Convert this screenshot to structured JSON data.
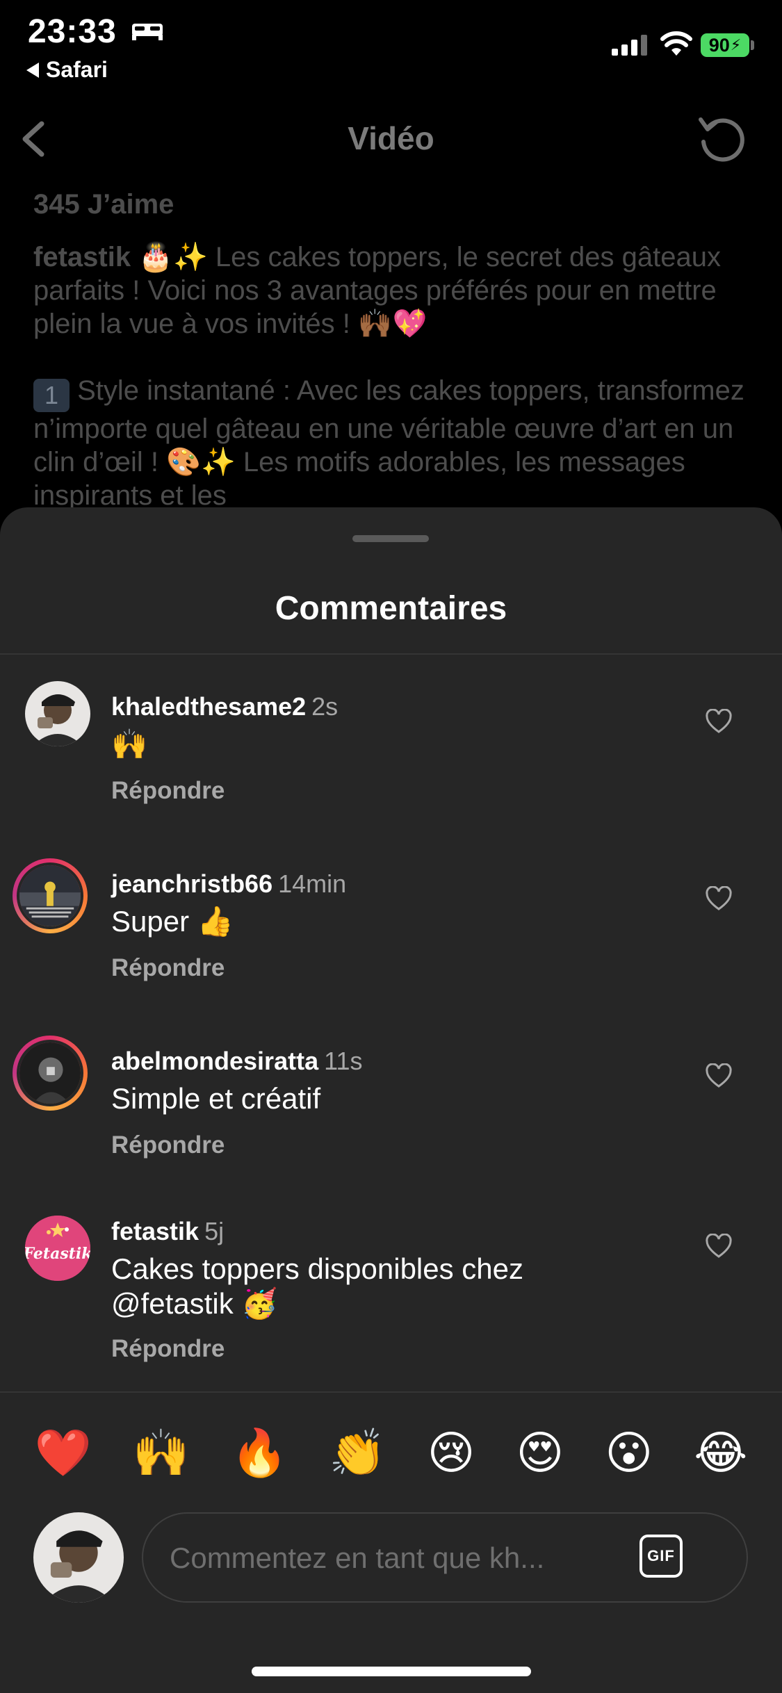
{
  "status": {
    "time": "23:33",
    "back_app": "Safari",
    "battery": "90"
  },
  "nav": {
    "title": "Vidéo"
  },
  "post": {
    "likes": "345 J’aime",
    "author": "fetastik",
    "caption": "🎂✨ Les cakes toppers, le secret des gâteaux parfaits ! Voici nos 3 avantages préférés pour en mettre plein la vue à vos invités ! 🙌🏾💖",
    "point_number": "1",
    "point_text": "Style instantané : Avec les cakes toppers, transformez n’importe quel gâteau en une véritable œuvre d’art en un clin d’œil ! 🎨✨ Les motifs adorables, les messages inspirants et les"
  },
  "sheet": {
    "title": "Commentaires"
  },
  "comments": [
    {
      "username": "khaledthesame2",
      "time": "2s",
      "text": "🙌",
      "reply": "Répondre"
    },
    {
      "username": "jeanchristb66",
      "time": "14min",
      "text": "Super 👍",
      "reply": "Répondre"
    },
    {
      "username": "abelmondesiratta",
      "time": "11s",
      "text": "Simple et créatif",
      "reply": "Répondre"
    },
    {
      "username": "fetastik",
      "time": "5j",
      "text": "Cakes toppers disponibles chez @fetastik 🥳",
      "reply": "Répondre",
      "avatar_text": "Fetastik"
    }
  ],
  "reactions": [
    "❤️",
    "🙌",
    "🔥",
    "👏",
    "😢",
    "😍",
    "😮",
    "😂"
  ],
  "composer": {
    "placeholder": "Commentez en tant que kh...",
    "gif_label": "GIF"
  },
  "colors": {
    "sheet_bg": "#262626",
    "battery": "#4cd964",
    "secondary_text": "#a8a8a8"
  }
}
